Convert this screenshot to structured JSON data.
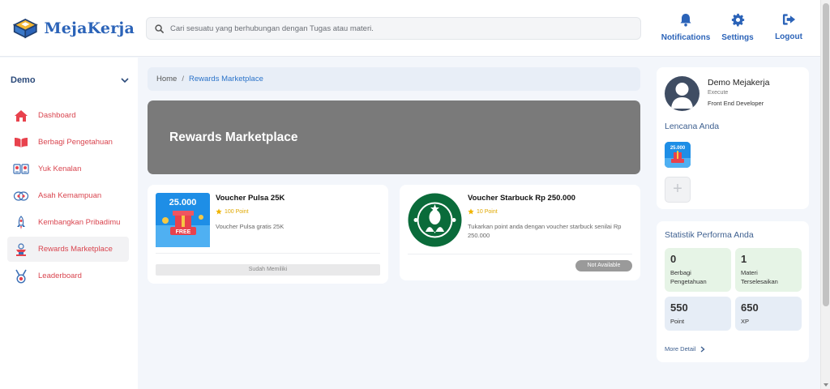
{
  "brand": {
    "name": "MejaKerja"
  },
  "search": {
    "placeholder": "Cari sesuatu yang berhubungan dengan Tugas atau materi."
  },
  "nav": {
    "notifications": "Notifications",
    "settings": "Settings",
    "logout": "Logout"
  },
  "sidebar": {
    "user": "Demo",
    "items": [
      {
        "label": "Dashboard",
        "icon": "home-icon"
      },
      {
        "label": "Berbagi Pengetahuan",
        "icon": "book-icon"
      },
      {
        "label": "Yuk Kenalan",
        "icon": "people-icon"
      },
      {
        "label": "Asah Kemampuan",
        "icon": "brain-icon"
      },
      {
        "label": "Kembangkan Pribadimu",
        "icon": "rocket-icon"
      },
      {
        "label": "Rewards Marketplace",
        "icon": "trophy-icon",
        "active": true
      },
      {
        "label": "Leaderboard",
        "icon": "medal-icon"
      }
    ]
  },
  "breadcrumb": {
    "home": "Home",
    "separator": "/",
    "current": "Rewards Marketplace"
  },
  "banner": {
    "title": "Rewards Marketplace"
  },
  "rewards": [
    {
      "name": "Voucher Pulsa 25K",
      "points": "100 Point",
      "description": "Voucher Pulsa gratis 25K",
      "image_text": "25.000",
      "image_sub": "FREE",
      "action": "Sudah Memiliki"
    },
    {
      "name": "Voucher Starbuck Rp 250.000",
      "points": "10 Point",
      "description": "Tukarkan point anda dengan voucher starbuck senilai Rp 250.000",
      "action": "Not Available"
    }
  ],
  "profile": {
    "name": "Demo Mejakerja",
    "role": "Execute",
    "job": "Front End Developer",
    "badges_title": "Lencana Anda",
    "badge_text": "25.000",
    "add_label": "+"
  },
  "stats": {
    "title": "Statistik Performa Anda",
    "items": [
      {
        "value": "0",
        "label": "Berbagi Pengetahuan"
      },
      {
        "value": "1",
        "label": "Materi Terselesaikan"
      },
      {
        "value": "550",
        "label": "Point"
      },
      {
        "value": "650",
        "label": "XP"
      }
    ],
    "more": "More Detail"
  },
  "colors": {
    "brand": "#2b63b8",
    "menu_text": "#d9454f",
    "banner": "#7a7a7a",
    "star": "#e0a800"
  }
}
